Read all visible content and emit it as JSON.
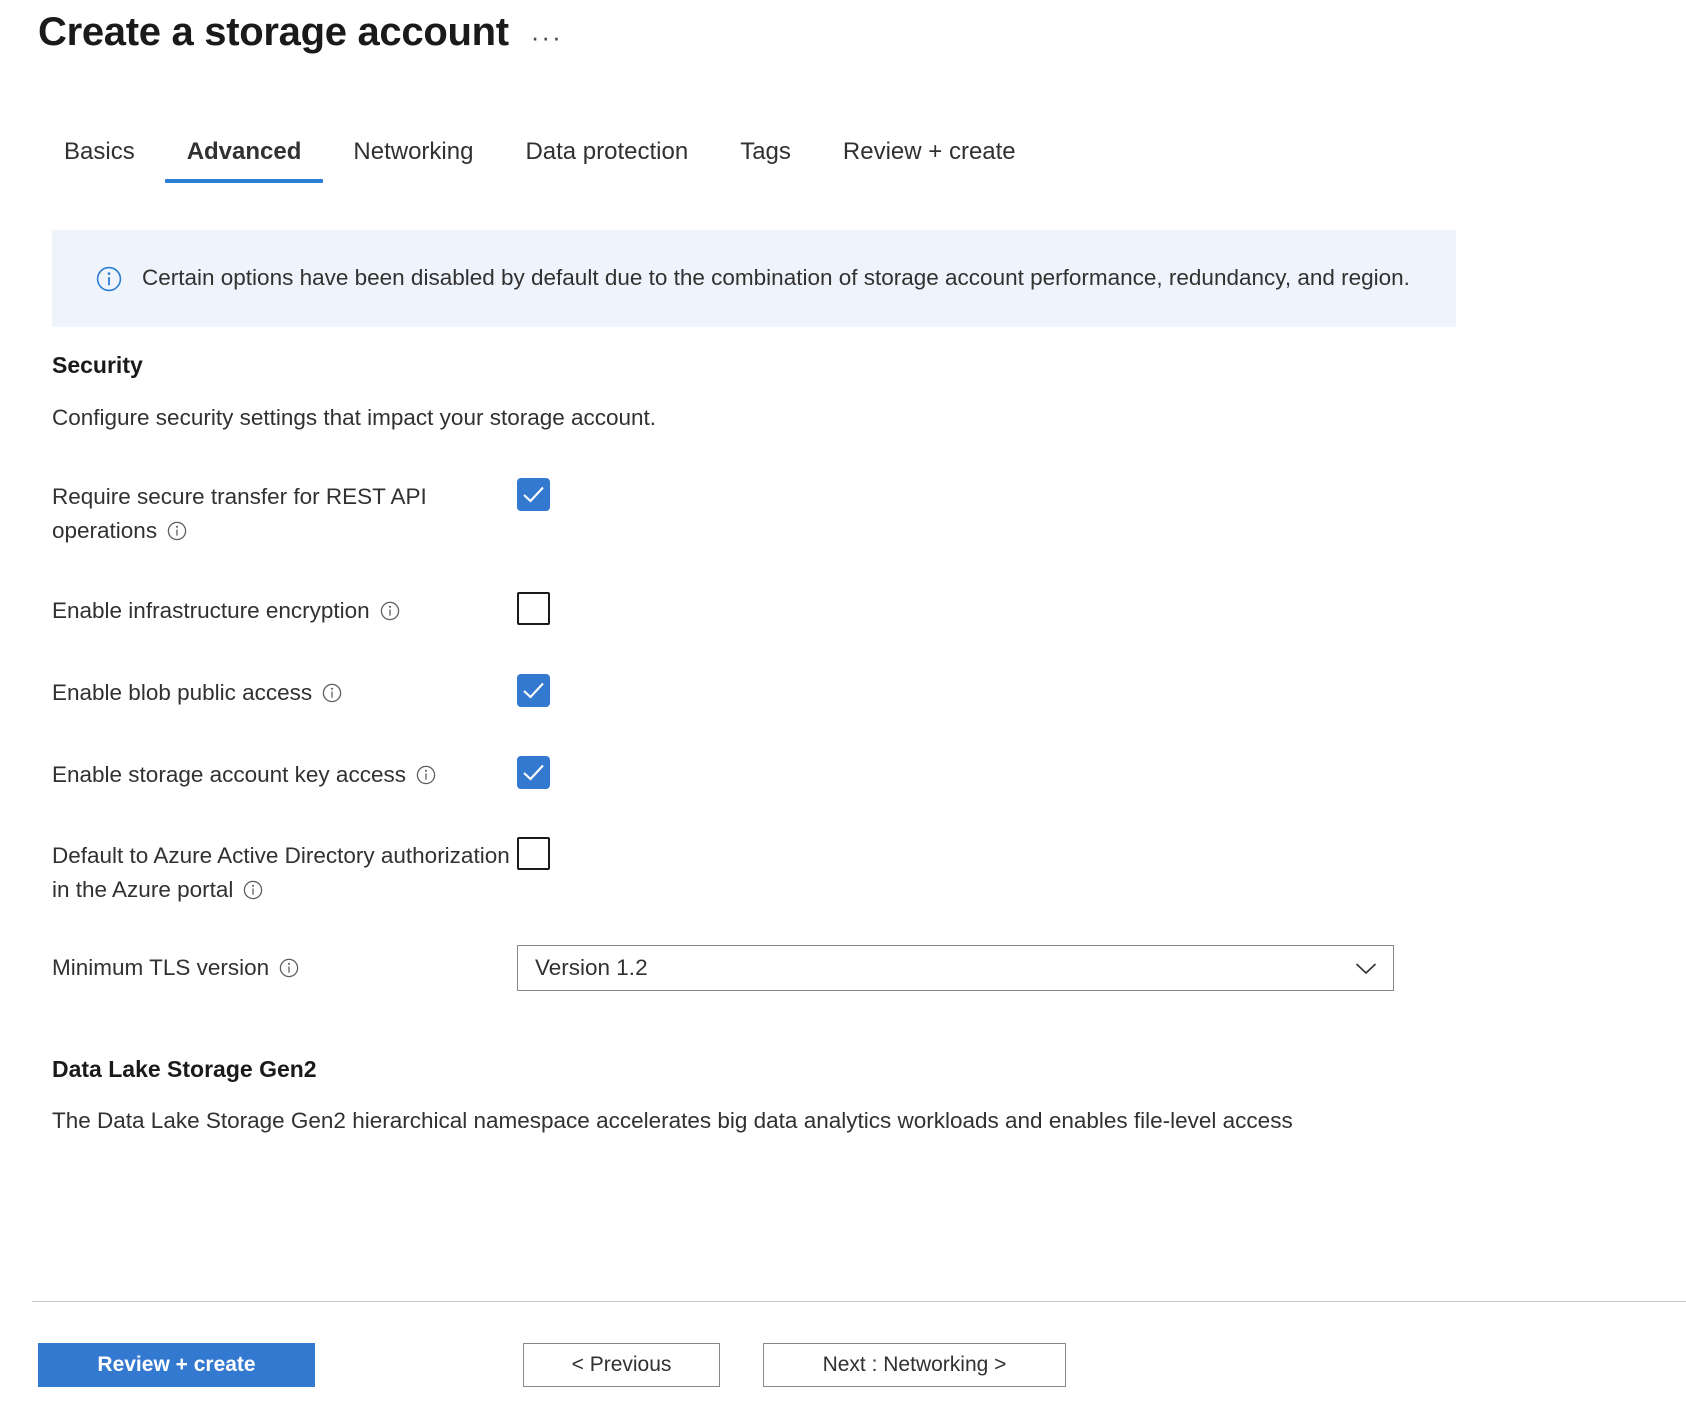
{
  "header": {
    "title": "Create a storage account",
    "more_menu": "···"
  },
  "tabs": [
    {
      "label": "Basics",
      "active": false
    },
    {
      "label": "Advanced",
      "active": true
    },
    {
      "label": "Networking",
      "active": false
    },
    {
      "label": "Data protection",
      "active": false
    },
    {
      "label": "Tags",
      "active": false
    },
    {
      "label": "Review + create",
      "active": false
    }
  ],
  "banner": {
    "icon": "info-icon",
    "text": "Certain options have been disabled by default due to the combination of storage account performance, redundancy, and region."
  },
  "security": {
    "heading": "Security",
    "description": "Configure security settings that impact your storage account.",
    "rows": [
      {
        "label": "Require secure transfer for REST API operations",
        "info_icon": "info-icon",
        "checked": true
      },
      {
        "label": "Enable infrastructure encryption",
        "info_icon": "info-icon",
        "checked": false
      },
      {
        "label": "Enable blob public access",
        "info_icon": "info-icon",
        "checked": true
      },
      {
        "label": "Enable storage account key access",
        "info_icon": "info-icon",
        "checked": true
      },
      {
        "label": "Default to Azure Active Directory authorization in the Azure portal",
        "info_icon": "info-icon",
        "checked": false
      }
    ],
    "tls": {
      "label": "Minimum TLS version",
      "info_icon": "info-icon",
      "value": "Version 1.2",
      "chevron_icon": "chevron-down-icon"
    }
  },
  "data_lake": {
    "heading": "Data Lake Storage Gen2",
    "description": "The Data Lake Storage Gen2 hierarchical namespace accelerates big data analytics workloads and enables file-level access"
  },
  "footer": {
    "review_create": "Review + create",
    "previous": "< Previous",
    "next": "Next : Networking >"
  },
  "colors": {
    "accent": "#3479d0",
    "tab_underline": "#2b7cd3",
    "banner_bg": "#eff4fc",
    "text": "#323130"
  }
}
